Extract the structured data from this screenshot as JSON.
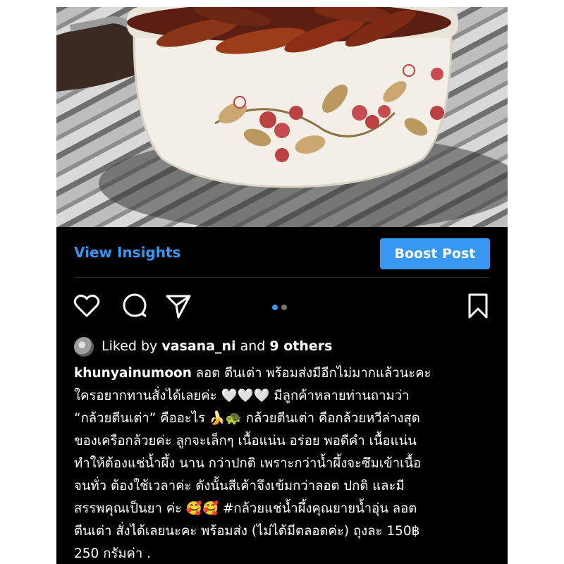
{
  "post": {
    "image": {
      "subject": "braised banana slices in a white enamel pot with floral pattern on a striped cloth"
    },
    "actions": {
      "view_insights": "View Insights",
      "boost_post": "Boost Post"
    },
    "icons": {
      "like": "heart-icon",
      "comment": "comment-icon",
      "share": "send-icon",
      "save": "bookmark-icon"
    },
    "carousel": {
      "total": 2,
      "active": 1
    },
    "likes": {
      "prefix": "Liked by",
      "user": "vasana_ni",
      "and": "and",
      "others": "9 others"
    },
    "caption": {
      "username": "khunyainumoon",
      "lines": [
        " ลอต ตีนเต่า พร้อมส่งมีอีกไม่มากแล้วนะคะ",
        "ใครอยากทานสั่งได้เลยค่ะ 🤍🤍🤍 มีลูกค้าหลายท่านถามว่า",
        "“กล้วยตีนเต่า” คืออะไร 🍌🐢 กล้วยตีนเต่า คือกล้วยหวีล่างสุด",
        "ของเครือกล้วยค่ะ ลูกจะเล็กๆ เนื้อแน่น อร่อย พอดีคำ เนื้อแน่น",
        "ทำให้ต้องแช่น้ำผึ้ง นาน กว่าปกติ เพราะกว่าน้ำผึ้งจะซึมเข้าเนื้อ",
        "จนทั่ว ต้องใช้เวลาค่ะ ดังนั้นสีเค้าจึงเข้มกว่าลอต ปกติ และมี",
        "สรรพคุณเป็นยา ค่ะ 🥰🥰 #กล้วยแช่น้ำผึ้งคุณยายน้ำอุ่น ลอต",
        "ตีนเต่า สั่งได้เลยนะคะ พร้อมส่ง (ไม่ได้มีตลอดค่ะ) ถุงละ 150฿",
        "250 กรัมค่า ."
      ]
    },
    "colors": {
      "accent_blue": "#3897f0",
      "background": "#000000",
      "text": "#ffffff",
      "dot_inactive": "#737373"
    }
  }
}
